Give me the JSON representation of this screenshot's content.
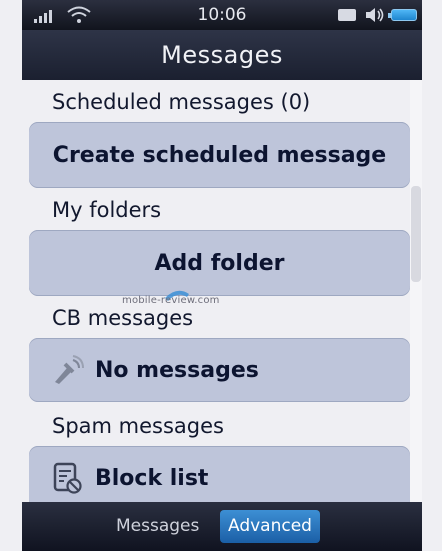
{
  "status_bar": {
    "time": "10:06",
    "icons": [
      "signal-icon",
      "wifi-icon",
      "message-icon",
      "speaker-icon",
      "battery-icon"
    ]
  },
  "header": {
    "title": "Messages"
  },
  "sections": [
    {
      "label": "Scheduled messages (0)",
      "button": "Create scheduled message"
    },
    {
      "label": "My folders",
      "button": "Add folder"
    },
    {
      "label": "CB messages",
      "button": "No messages",
      "button_icon": "broadcast-icon"
    },
    {
      "label": "Spam messages",
      "button": "Block list",
      "button_icon": "block-list-icon"
    }
  ],
  "watermark": "mobile-review.com",
  "tabs": [
    {
      "label": "Messages",
      "active": false
    },
    {
      "label": "Advanced",
      "active": true
    }
  ],
  "colors": {
    "tile": "#bec5da",
    "tab_active": "#2d7cc6",
    "header_bg": "#252a3b"
  }
}
